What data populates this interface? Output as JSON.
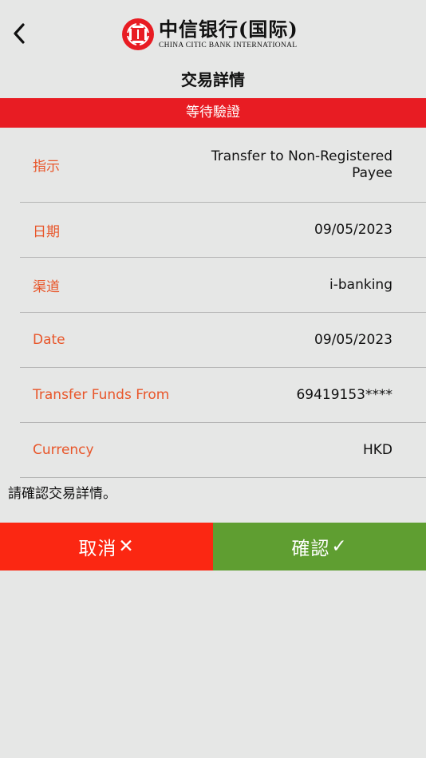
{
  "header": {
    "back_icon": "chevron-left-icon",
    "logo": {
      "name_cn": "中信银行(国际)",
      "name_en": "CHINA CITIC BANK INTERNATIONAL",
      "color": "#e81c23"
    }
  },
  "page": {
    "title": "交易詳情"
  },
  "status": {
    "label": "等待驗證",
    "color": "#e81c23"
  },
  "details": {
    "label_color": "#e8562a",
    "rows": [
      {
        "label": "指示",
        "value": "Transfer to Non-Registered Payee"
      },
      {
        "label": "日期",
        "value": "09/05/2023"
      },
      {
        "label": "渠道",
        "value": "i-banking"
      },
      {
        "label": "Date",
        "value": "09/05/2023"
      },
      {
        "label": "Transfer Funds From",
        "value": "69419153****"
      },
      {
        "label": "Currency",
        "value": "HKD"
      }
    ]
  },
  "confirm_note": "請確認交易詳情。",
  "actions": {
    "cancel": {
      "label": "取消",
      "glyph": "✕",
      "color": "#fb2712"
    },
    "confirm": {
      "label": "確認",
      "glyph": "✓",
      "color": "#5f9e31"
    }
  }
}
